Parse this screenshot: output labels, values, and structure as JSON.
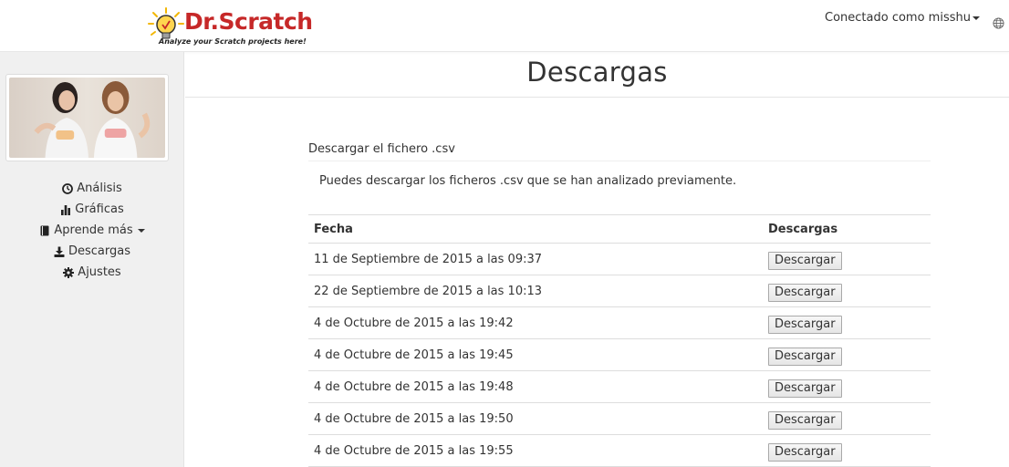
{
  "header": {
    "logo_title": "Dr.Scratch",
    "logo_tagline": "Analyze your Scratch projects here!",
    "user_menu_label": "Conectado como misshu",
    "globe_icon": "globe-icon"
  },
  "sidebar": {
    "items": [
      {
        "label": "Análisis",
        "icon": "dashboard-icon"
      },
      {
        "label": "Gráficas",
        "icon": "bar-chart-icon"
      },
      {
        "label": "Aprende más",
        "icon": "book-icon"
      },
      {
        "label": "Descargas",
        "icon": "download-icon"
      },
      {
        "label": "Ajustes",
        "icon": "gear-icon"
      }
    ]
  },
  "main": {
    "page_title": "Descargas",
    "panel_heading": "Descargar el fichero .csv",
    "panel_body": "Puedes descargar los ficheros .csv que se han analizado previamente.",
    "table": {
      "headers": [
        "Fecha",
        "Descargas"
      ],
      "rows": [
        {
          "fecha": "11 de Septiembre de 2015 a las 09:37",
          "button": "Descargar"
        },
        {
          "fecha": "22 de Septiembre de 2015 a las 10:13",
          "button": "Descargar"
        },
        {
          "fecha": "4 de Octubre de 2015 a las 19:42",
          "button": "Descargar"
        },
        {
          "fecha": "4 de Octubre de 2015 a las 19:45",
          "button": "Descargar"
        },
        {
          "fecha": "4 de Octubre de 2015 a las 19:48",
          "button": "Descargar"
        },
        {
          "fecha": "4 de Octubre de 2015 a las 19:50",
          "button": "Descargar"
        },
        {
          "fecha": "4 de Octubre de 2015 a las 19:55",
          "button": "Descargar"
        }
      ]
    }
  },
  "colors": {
    "brand_red": "#c62828",
    "sidebar_bg": "#f0f0f0"
  }
}
